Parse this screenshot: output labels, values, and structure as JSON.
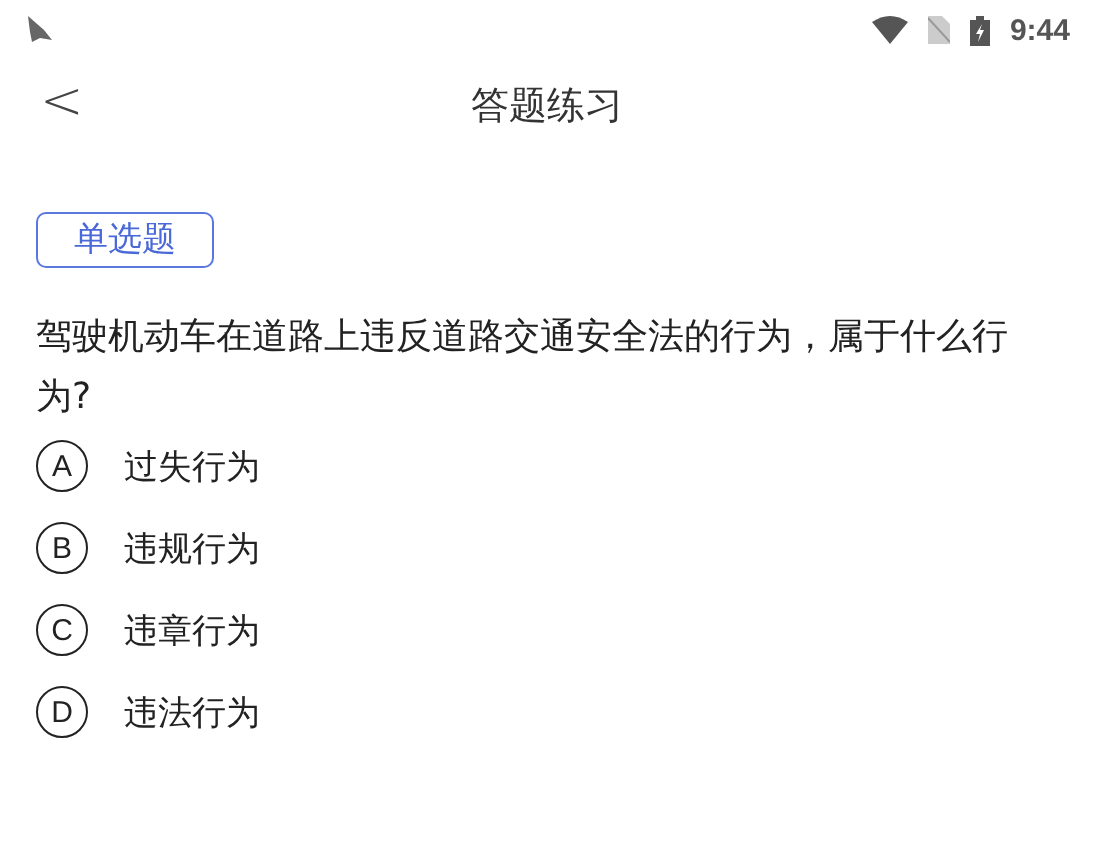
{
  "status_bar": {
    "time": "9:44"
  },
  "header": {
    "back": "<",
    "title": "答题练习"
  },
  "question": {
    "type_tag": "单选题",
    "text": "驾驶机动车在道路上违反道路交通安全法的行为，属于什么行为?",
    "options": [
      {
        "letter": "A",
        "text": "过失行为"
      },
      {
        "letter": "B",
        "text": "违规行为"
      },
      {
        "letter": "C",
        "text": "违章行为"
      },
      {
        "letter": "D",
        "text": "违法行为"
      }
    ]
  }
}
